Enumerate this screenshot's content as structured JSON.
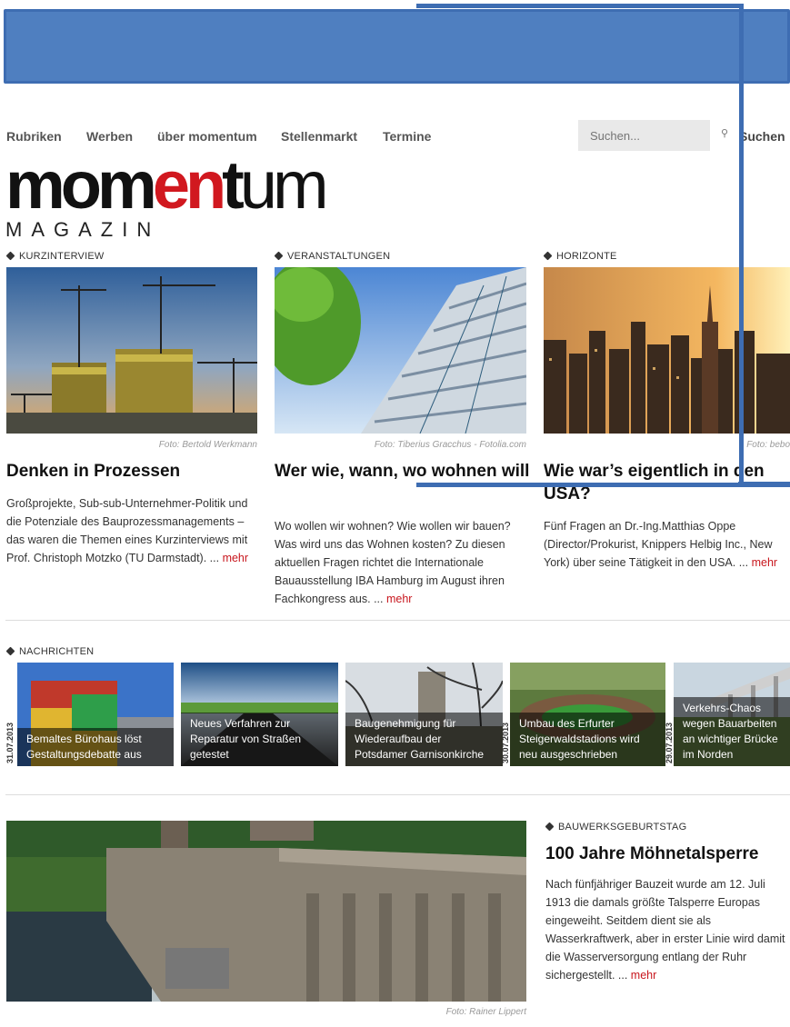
{
  "nav": {
    "items": [
      "Rubriken",
      "Werben",
      "über momentum",
      "Stellenmarkt",
      "Termine"
    ],
    "search_placeholder": "Suchen...",
    "search_button": "Suchen"
  },
  "logo": {
    "part1": "mom",
    "part2": "en",
    "part3": "t",
    "part4": "um",
    "subtitle": "MAGAZIN"
  },
  "features": [
    {
      "category": "KURZINTERVIEW",
      "caption": "Foto: Bertold Werkmann",
      "title": "Denken in Prozessen",
      "teaser": "Großprojekte, Sub-sub-Unternehmer-Politik und die Potenziale des Bauprozessmanagements – das waren die Themen eines Kurzinterviews mit Prof. Christoph Motzko (TU Darmstadt). ... ",
      "more": "mehr"
    },
    {
      "category": "VERANSTALTUNGEN",
      "caption": "Foto: Tiberius Gracchus - Fotolia.com",
      "title": "Wer wie, wann, wo wohnen will",
      "teaser": "Wo wollen wir wohnen? Wie wollen wir bauen? Was wird uns das Wohnen kosten? Zu diesen aktuellen Fragen richtet die Internationale Bauausstellung IBA Hamburg im August ihren Fachkongress aus. ... ",
      "more": "mehr"
    },
    {
      "category": "HORIZONTE",
      "caption": "Foto: bebo",
      "title": "Wie war’s eigentlich in den USA?",
      "teaser": "Fünf Fragen an Dr.-Ing.Matthias Oppe (Director/Prokurist, Knippers Helbig Inc., New York) über seine Tätigkeit in den USA. ... ",
      "more": "mehr"
    }
  ],
  "news": {
    "category": "NACHRICHTEN",
    "items": [
      {
        "date": "31.07.2013",
        "text": "Bemaltes Bürohaus löst Gestaltungsdebatte aus"
      },
      {
        "date": "",
        "text": "Neues Verfahren zur Reparatur von Straßen getestet"
      },
      {
        "date": "30.07.2013",
        "text": "Baugenehmigung für Wiederaufbau der Potsdamer Garnisonkirche"
      },
      {
        "date": "29.07.2013",
        "text": "Umbau des Erfurter Steigerwaldstadions wird neu ausgeschrieben"
      },
      {
        "date": "",
        "text": "Verkehrs-Chaos wegen Bauarbeiten an wichtiger Brücke im Norden"
      }
    ]
  },
  "bottom": {
    "category": "BAUWERKSGEBURTSTAG",
    "title": "100 Jahre Möhnetalsperre",
    "teaser": "Nach fünfjähriger Bauzeit wurde am 12. Juli 1913 die damals größte Talsperre Europas eingeweiht. Seitdem dient sie als Wasserkraftwerk, aber in erster Linie wird damit die Wasserversorgung entlang der Ruhr sichergestellt. ... ",
    "more": "mehr",
    "caption": "Foto: Rainer Lippert"
  }
}
